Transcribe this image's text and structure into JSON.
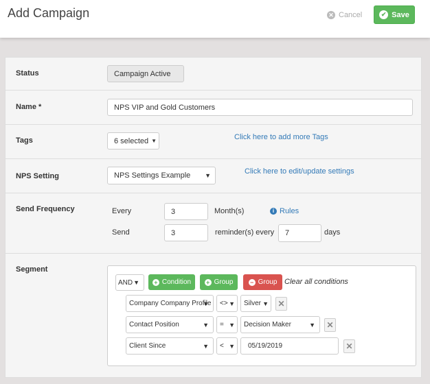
{
  "header": {
    "title": "Add Campaign",
    "cancel_label": "Cancel",
    "save_label": "Save"
  },
  "form": {
    "status": {
      "label": "Status",
      "value": "Campaign Active"
    },
    "name": {
      "label": "Name *",
      "value": "NPS VIP and Gold Customers"
    },
    "tags": {
      "label": "Tags",
      "value": "6 selected",
      "link": "Click here to add more Tags"
    },
    "nps": {
      "label": "NPS Setting",
      "value": "NPS Settings Example",
      "link": "Click here to edit/update settings"
    },
    "frequency": {
      "label": "Send Frequency",
      "every_label": "Every",
      "every_value": "3",
      "unit_label": "Month(s)",
      "rules_link": "Rules",
      "send_label": "Send",
      "send_value": "3",
      "reminder_label": "reminder(s) every",
      "days_value": "7",
      "days_label": "days"
    },
    "segment": {
      "label": "Segment",
      "operator": "AND",
      "add_condition": "Condition",
      "add_group": "Group",
      "remove_group": "Group",
      "clear_all": "Clear all conditions",
      "conditions": [
        {
          "field": "Company Company Profile",
          "op": "<>",
          "value": "Silver"
        },
        {
          "field": "Contact Position",
          "op": "=",
          "value": "Decision Maker"
        },
        {
          "field": "Client Since",
          "op": "<",
          "value": "05/19/2019"
        }
      ]
    }
  },
  "icons": {
    "cancel": "x-circle-icon",
    "save": "check-circle-icon",
    "info": "info-icon",
    "remove": "close-icon"
  },
  "colors": {
    "primary_green": "#5cb85c",
    "danger_red": "#d9534f",
    "link_blue": "#337ab7"
  }
}
